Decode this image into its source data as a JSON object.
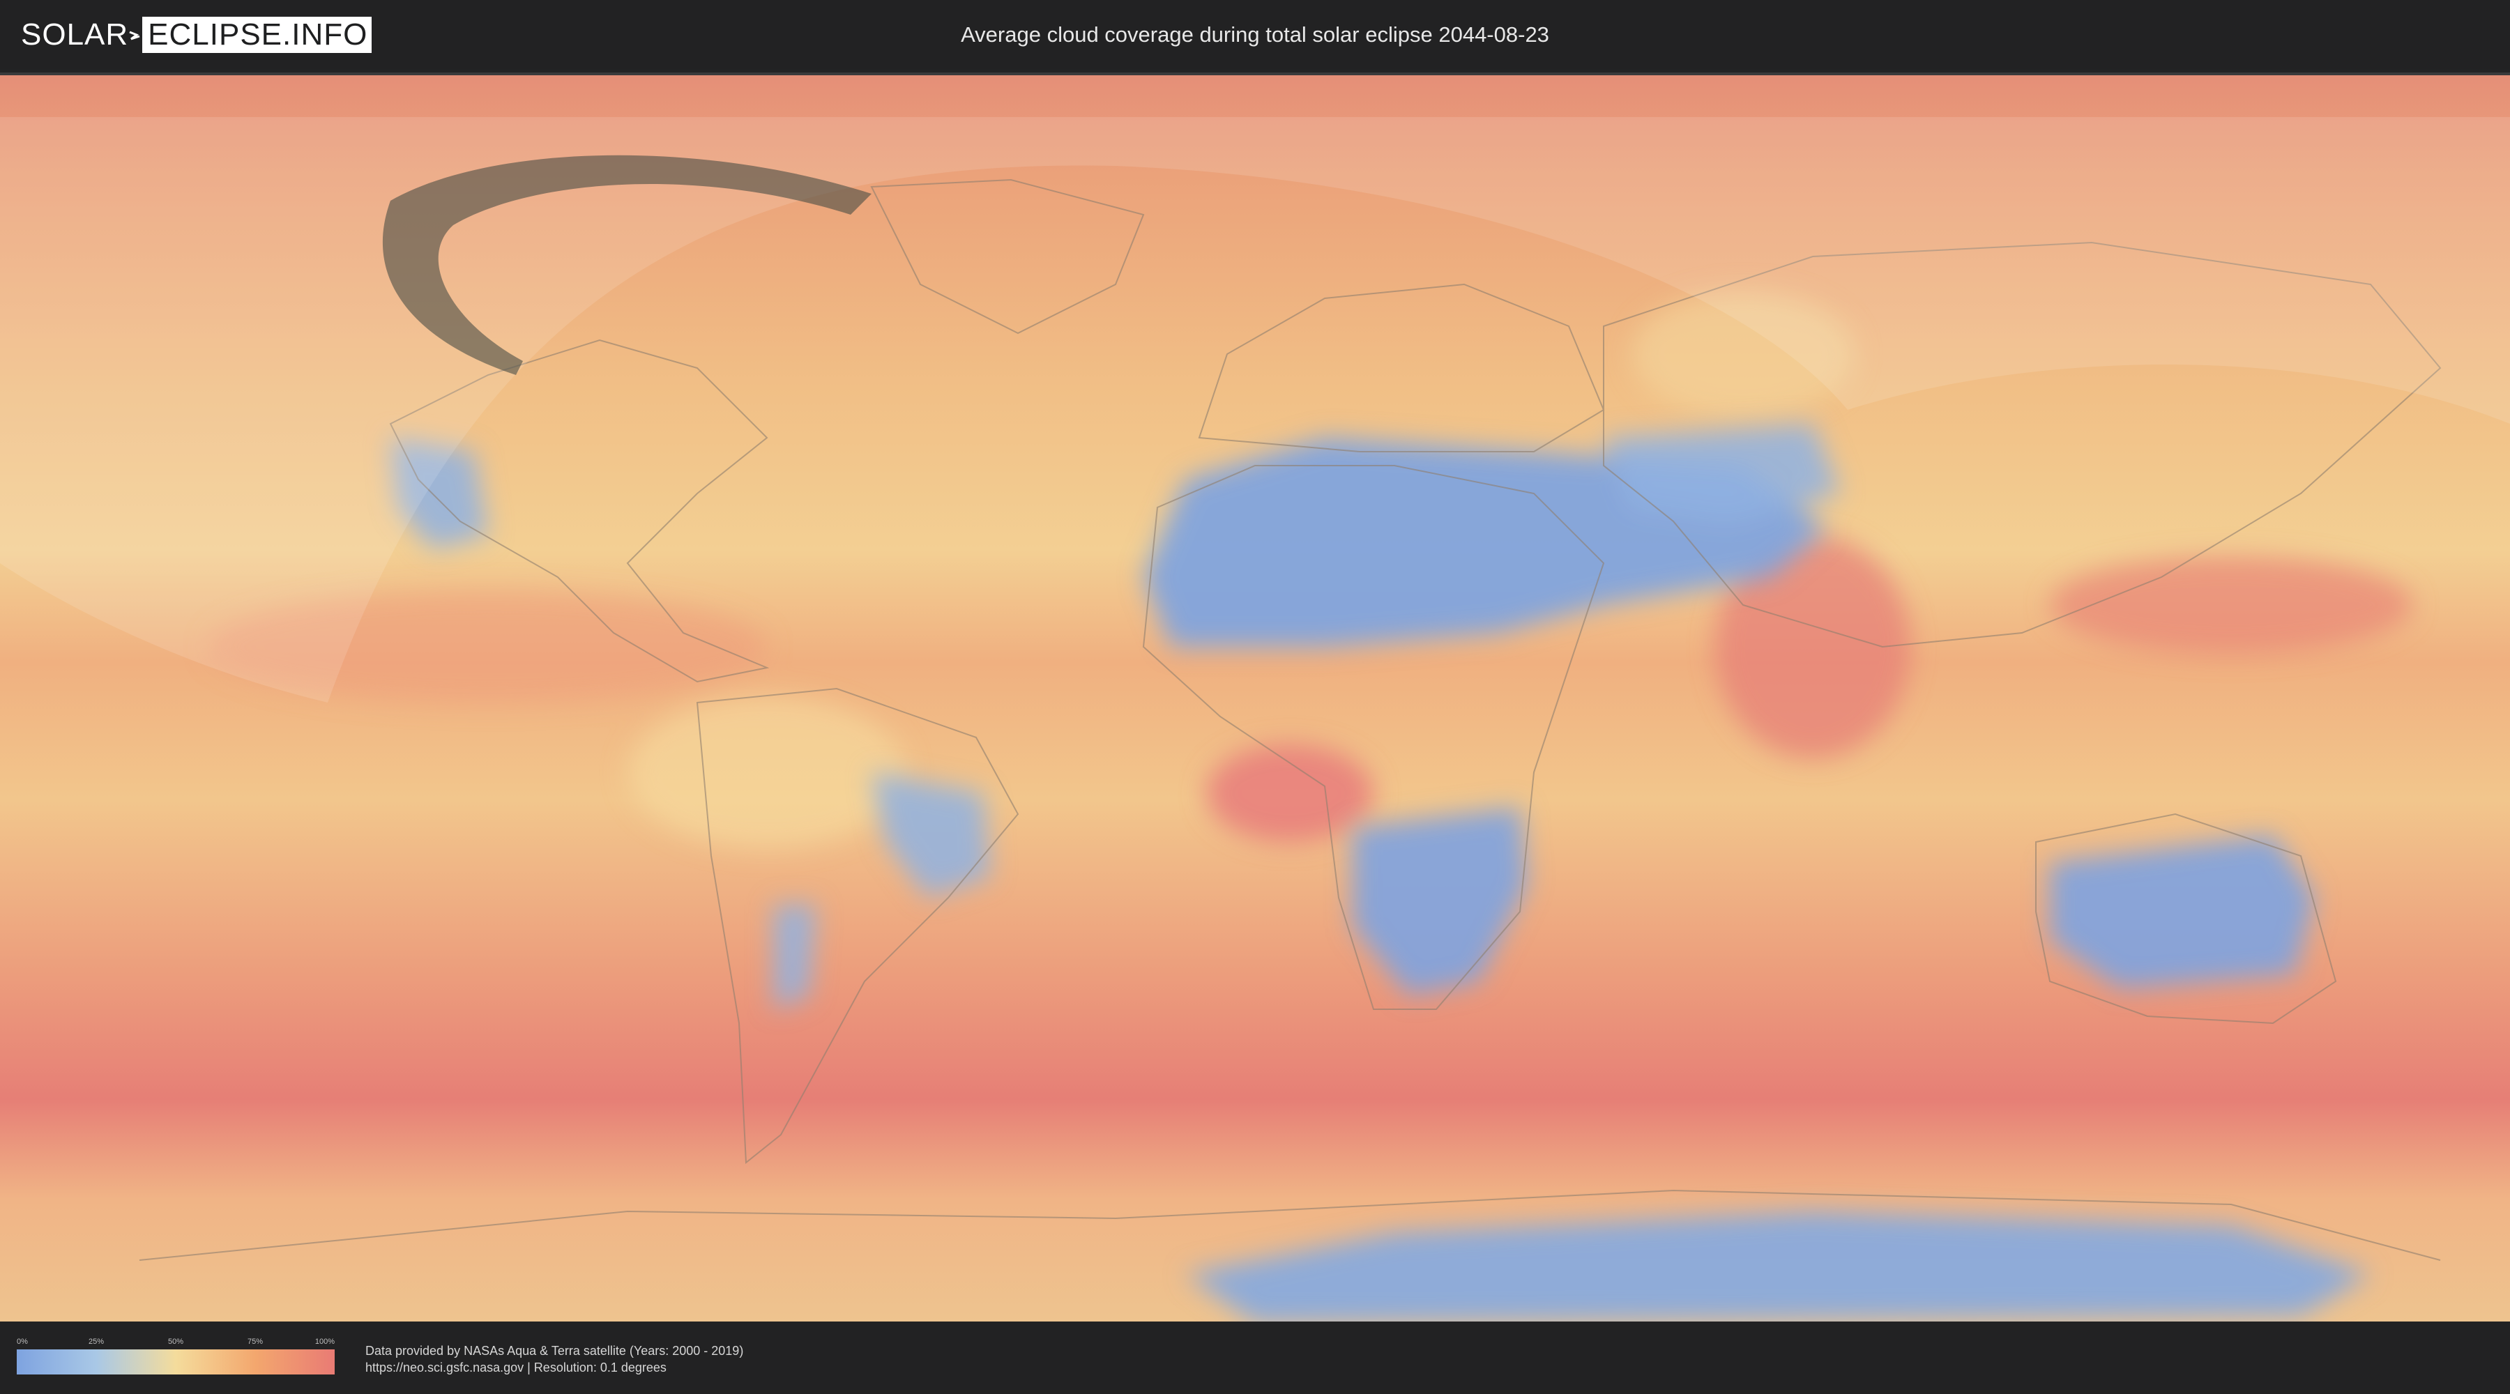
{
  "header": {
    "logo_left": "SOLAR",
    "logo_right": "ECLIPSE.INFO",
    "title": "Average cloud coverage during total solar eclipse 2044-08-23"
  },
  "map": {
    "projection": "equirectangular",
    "eclipse_date": "2044-08-23",
    "colors": {
      "clear": "#7ea3e0",
      "low": "#a9c8e6",
      "mid": "#f4dc9c",
      "high": "#f3a76e",
      "overcast": "#e97b74"
    }
  },
  "legend": {
    "ticks": [
      "0%",
      "25%",
      "50%",
      "75%",
      "100%"
    ]
  },
  "credits": {
    "line1": "Data provided by NASAs Aqua & Terra satellite (Years: 2000 - 2019)",
    "line2": "https://neo.sci.gsfc.nasa.gov | Resolution: 0.1 degrees"
  }
}
